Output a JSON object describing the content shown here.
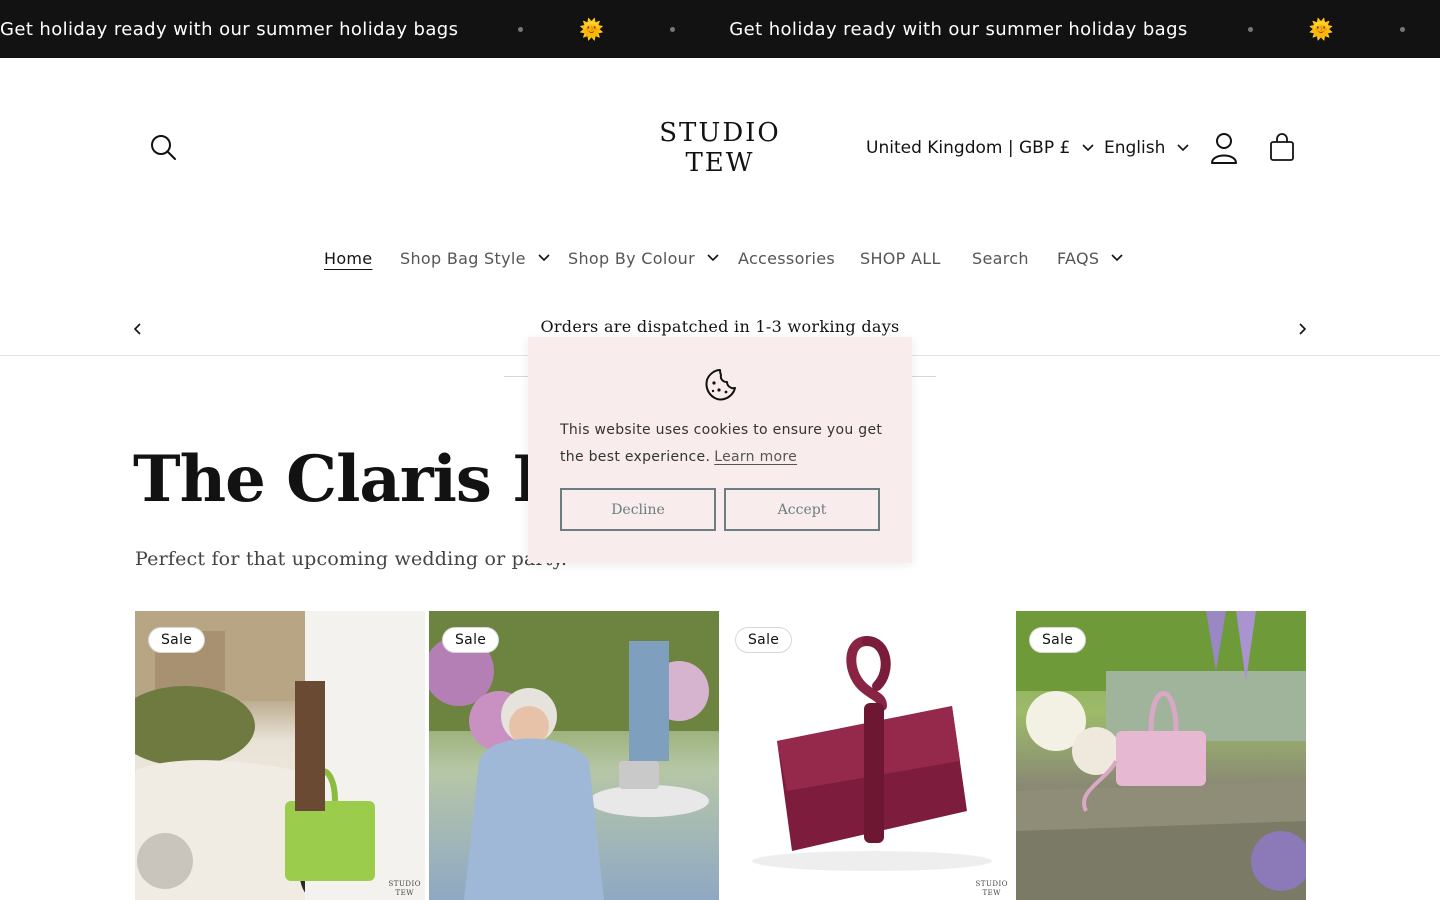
{
  "announcement_marquee": {
    "message": "Get holiday ready with our summer holiday bags",
    "separator_icon": "sun-icon"
  },
  "header": {
    "logo_line1": "STUDIO",
    "logo_line2": "TEW",
    "country_selector": "United Kingdom | GBP £",
    "language_selector": "English",
    "icons": [
      "search-icon",
      "account-icon",
      "cart-icon"
    ]
  },
  "nav": {
    "items": [
      {
        "label": "Home",
        "active": true
      },
      {
        "label": "Shop Bag Style",
        "has_dropdown": true
      },
      {
        "label": "Shop By Colour",
        "has_dropdown": true
      },
      {
        "label": "Accessories"
      },
      {
        "label": "SHOP ALL"
      },
      {
        "label": "Search"
      },
      {
        "label": "FAQS",
        "has_dropdown": true
      }
    ]
  },
  "announcement_bar": {
    "text": "Orders are dispatched in 1-3 working days"
  },
  "hero": {
    "title": "The Claris Bag",
    "subtitle": "Perfect for that upcoming wedding or party."
  },
  "products": [
    {
      "badge": "Sale",
      "watermark_line1": "STUDIO",
      "watermark_line2": "TEW"
    },
    {
      "badge": "Sale"
    },
    {
      "badge": "Sale",
      "watermark_line1": "STUDIO",
      "watermark_line2": "TEW"
    },
    {
      "badge": "Sale"
    }
  ],
  "cookie_banner": {
    "message": "This website uses cookies to ensure you get the best experience.",
    "learn_more": "Learn more",
    "decline": "Decline",
    "accept": "Accept",
    "background": "#f9ecec",
    "button_color": "#6b7d80"
  }
}
